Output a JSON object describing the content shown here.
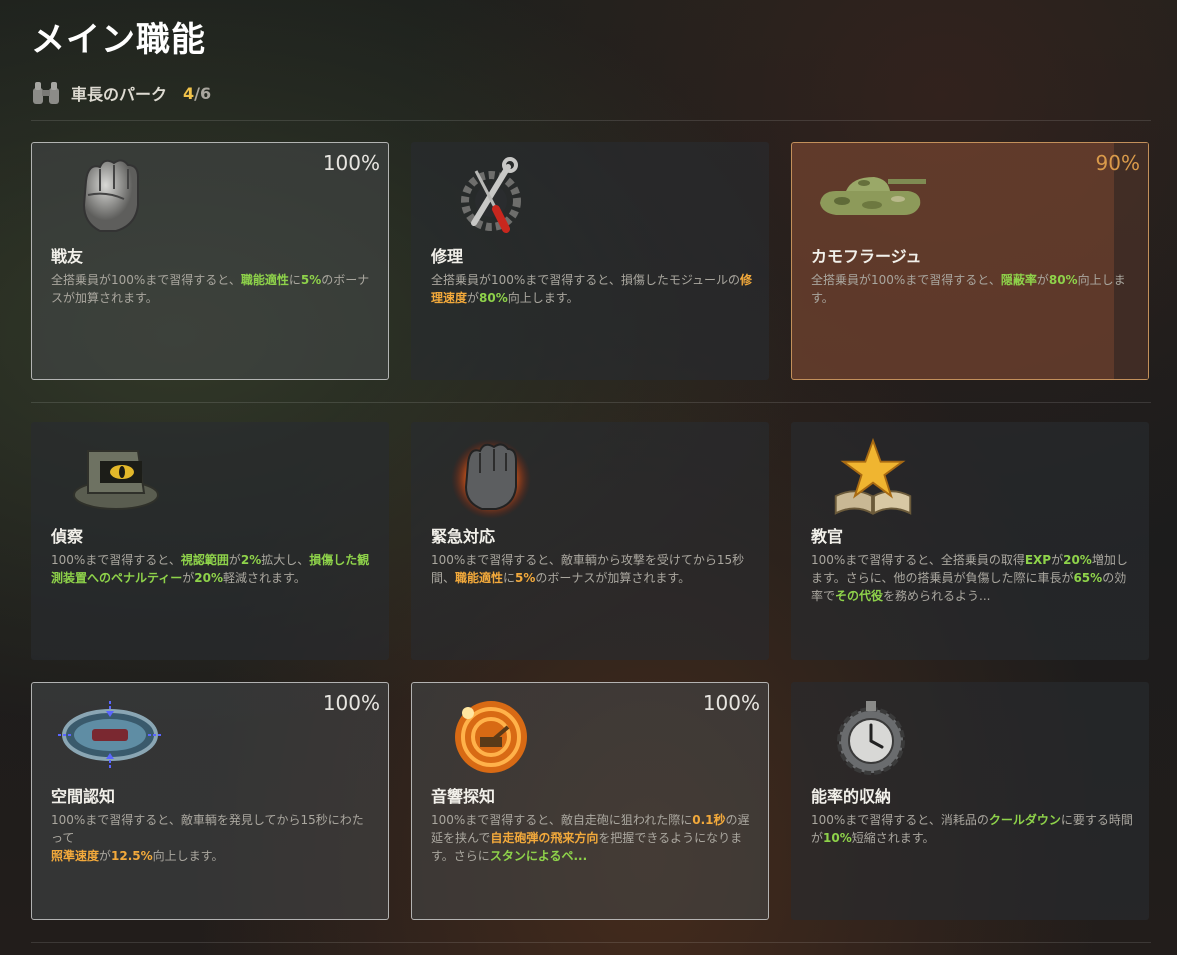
{
  "page_title": "メイン職能",
  "section": {
    "label": "車長のパーク",
    "count": "4",
    "total": "/6"
  },
  "perks": [
    {
      "name": "戦友",
      "percent": "100%",
      "desc": [
        {
          "t": "全搭乗員が100%まで習得すると、"
        },
        {
          "t": "職能適性",
          "c": "g"
        },
        {
          "t": "に"
        },
        {
          "t": "5%",
          "c": "g"
        },
        {
          "t": "のボーナスが加算されます。"
        }
      ]
    },
    {
      "name": "修理",
      "percent": "",
      "desc": [
        {
          "t": "全搭乗員が100%まで習得すると、損傷したモジュールの"
        },
        {
          "t": "修理速度",
          "c": "o"
        },
        {
          "t": "が"
        },
        {
          "t": "80%",
          "c": "g"
        },
        {
          "t": "向上します。"
        }
      ]
    },
    {
      "name": "カモフラージュ",
      "percent": "90%",
      "desc": [
        {
          "t": "全搭乗員が100%まで習得すると、"
        },
        {
          "t": "隠蔽率",
          "c": "g"
        },
        {
          "t": "が"
        },
        {
          "t": "80%",
          "c": "g"
        },
        {
          "t": "向上します。"
        }
      ]
    },
    {
      "name": "偵察",
      "percent": "",
      "desc": [
        {
          "t": "100%まで習得すると、"
        },
        {
          "t": "視認範囲",
          "c": "g"
        },
        {
          "t": "が"
        },
        {
          "t": "2%",
          "c": "g"
        },
        {
          "t": "拡大し、"
        },
        {
          "t": "損傷した観測装置へのペナルティー",
          "c": "g"
        },
        {
          "t": "が"
        },
        {
          "t": "20%",
          "c": "g"
        },
        {
          "t": "軽減されます。"
        }
      ]
    },
    {
      "name": "緊急対応",
      "percent": "",
      "desc": [
        {
          "t": "100%まで習得すると、敵車輌から攻撃を受けてから15秒間、"
        },
        {
          "t": "職能適性",
          "c": "o"
        },
        {
          "t": "に"
        },
        {
          "t": "5%",
          "c": "o"
        },
        {
          "t": "のボーナスが加算されます。"
        }
      ]
    },
    {
      "name": "教官",
      "percent": "",
      "desc": [
        {
          "t": "100%まで習得すると、全搭乗員の取得"
        },
        {
          "t": "EXP",
          "c": "g"
        },
        {
          "t": "が"
        },
        {
          "t": "20%",
          "c": "g"
        },
        {
          "t": "増加します。さらに、他の搭乗員が負傷した際に車長が"
        },
        {
          "t": "65%",
          "c": "g"
        },
        {
          "t": "の効率で"
        },
        {
          "t": "その代役",
          "c": "g"
        },
        {
          "t": "を務められるよう..."
        }
      ]
    },
    {
      "name": "空間認知",
      "percent": "100%",
      "desc": [
        {
          "t": "100%まで習得すると、敵車輌を発見してから15秒にわたって"
        },
        {
          "br": true
        },
        {
          "t": "照準速度",
          "c": "o"
        },
        {
          "t": "が"
        },
        {
          "t": "12.5%",
          "c": "o"
        },
        {
          "t": "向上します。"
        }
      ]
    },
    {
      "name": "音響探知",
      "percent": "100%",
      "desc": [
        {
          "t": "100%まで習得すると、敵自走砲に狙われた際に"
        },
        {
          "t": "0.1秒",
          "c": "o"
        },
        {
          "t": "の遅延を挟んで"
        },
        {
          "t": "自走砲弾の飛来方向",
          "c": "o"
        },
        {
          "t": "を把握できるようになります。さらに"
        },
        {
          "t": "スタンによるペ...",
          "c": "g"
        }
      ]
    },
    {
      "name": "能率的収納",
      "percent": "",
      "desc": [
        {
          "t": "100%まで習得すると、消耗品の"
        },
        {
          "t": "クールダウン",
          "c": "g"
        },
        {
          "t": "に要する時間が"
        },
        {
          "t": "10%",
          "c": "g"
        },
        {
          "t": "短縮されます。"
        }
      ]
    }
  ]
}
